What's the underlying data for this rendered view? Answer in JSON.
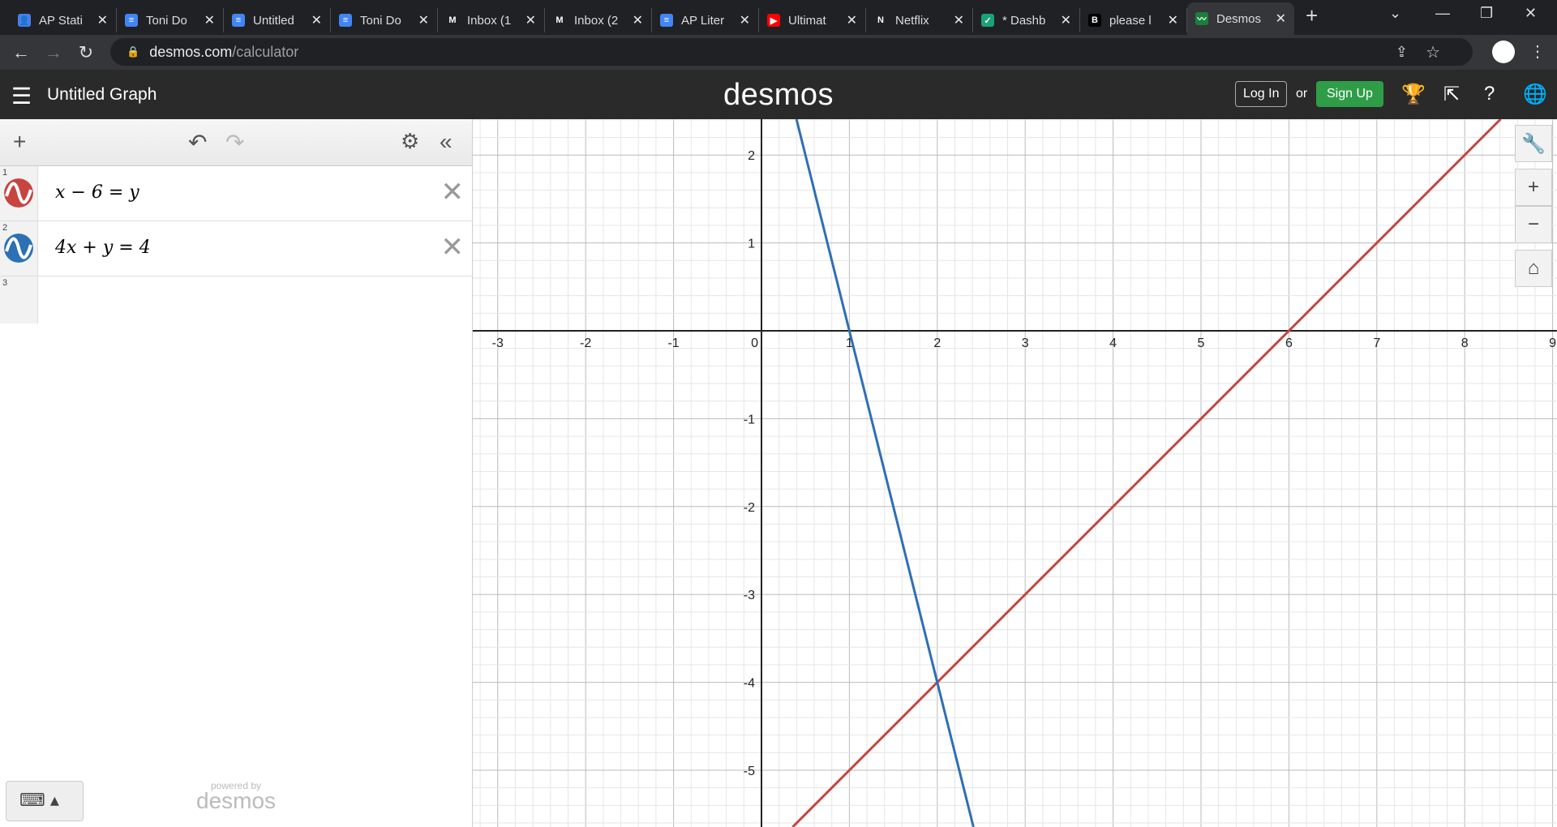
{
  "browser": {
    "tabs": [
      {
        "title": "AP Stati",
        "color": "#4a7fe6",
        "glyph": "👤"
      },
      {
        "title": "Toni Do",
        "color": "#4285f4",
        "glyph": "≡"
      },
      {
        "title": "Untitled",
        "color": "#4285f4",
        "glyph": "≡"
      },
      {
        "title": "Toni Do",
        "color": "#4285f4",
        "glyph": "≡"
      },
      {
        "title": "Inbox (1",
        "color": "#202124",
        "glyph": "M"
      },
      {
        "title": "Inbox (2",
        "color": "#202124",
        "glyph": "M"
      },
      {
        "title": "AP Liter",
        "color": "#4285f4",
        "glyph": "≡"
      },
      {
        "title": "Ultimat",
        "color": "#ff0000",
        "glyph": "▶"
      },
      {
        "title": "Netflix",
        "color": "#202124",
        "glyph": "N"
      },
      {
        "title": "* Dashb",
        "color": "#1aa179",
        "glyph": "✓"
      },
      {
        "title": "please l",
        "color": "#000000",
        "glyph": "B"
      },
      {
        "title": "Desmos",
        "color": "#1a7f3c",
        "glyph": "〰"
      }
    ],
    "active_tab": 11,
    "url_host": "desmos.com",
    "url_path": "/calculator"
  },
  "header": {
    "menu": "☰",
    "title": "Untitled Graph",
    "logo": "desmos",
    "login": "Log In",
    "or": "or",
    "signup": "Sign Up"
  },
  "expressions": [
    {
      "num": "1",
      "latex": "x − 6 = y",
      "color": "#c74440",
      "a": 1,
      "b": -6
    },
    {
      "num": "2",
      "latex": "4x + y = 4",
      "color": "#2d70b3",
      "a": -4,
      "b": 4
    },
    {
      "num": "3",
      "latex": ""
    }
  ],
  "footer": {
    "powered": "powered by",
    "brand": "desmos"
  },
  "chart_data": {
    "type": "line",
    "xlim": [
      -3.2,
      9.1
    ],
    "ylim": [
      -5.6,
      2.4
    ],
    "x_ticks": [
      -3,
      -2,
      -1,
      0,
      1,
      2,
      3,
      4,
      5,
      6,
      7,
      8,
      9
    ],
    "y_ticks": [
      -5,
      -4,
      -3,
      -2,
      -1,
      1,
      2
    ],
    "series": [
      {
        "name": "x − 6 = y",
        "slope": 1,
        "intercept": -6,
        "color": "#c74440"
      },
      {
        "name": "4x + y = 4",
        "slope": -4,
        "intercept": 4,
        "color": "#2d70b3"
      }
    ],
    "intersection": [
      2,
      -4
    ],
    "grid": true
  }
}
